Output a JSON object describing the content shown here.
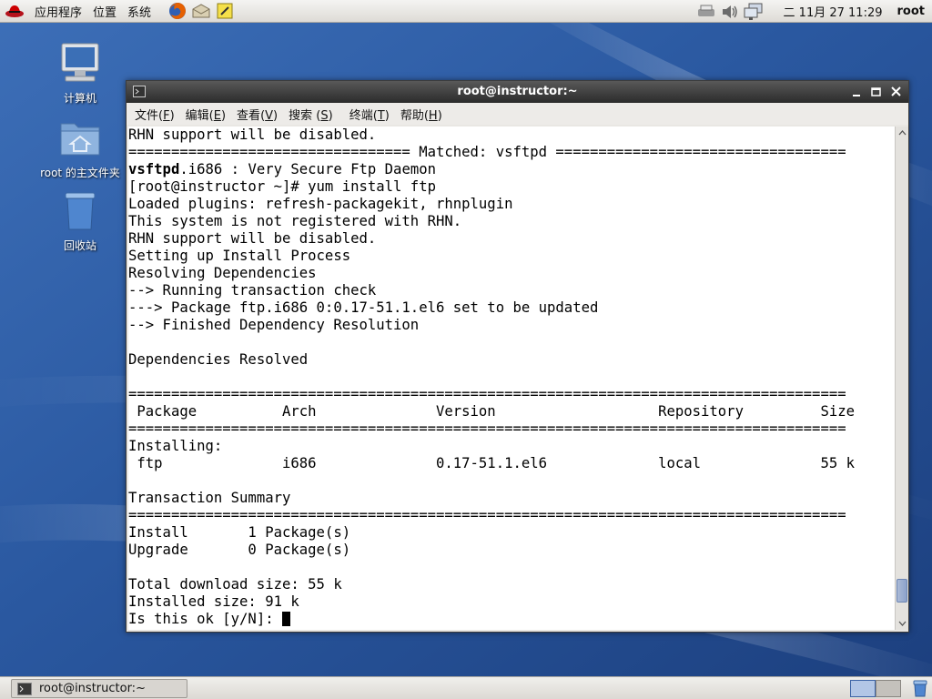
{
  "top_panel": {
    "menus": [
      "应用程序",
      "位置",
      "系统"
    ],
    "clock": "二 11月 27 11:29",
    "user": "root"
  },
  "desktop": {
    "icons": [
      {
        "label": "计算机",
        "icon": "computer-icon"
      },
      {
        "label": "root 的主文件夹",
        "icon": "home-folder-icon"
      },
      {
        "label": "回收站",
        "icon": "trash-icon"
      }
    ]
  },
  "terminal": {
    "title": "root@instructor:~",
    "menu": [
      {
        "label": "文件",
        "key": "F"
      },
      {
        "label": "编辑",
        "key": "E"
      },
      {
        "label": "查看",
        "key": "V"
      },
      {
        "label": "搜索",
        "key": "S"
      },
      {
        "label": "终端",
        "key": "T"
      },
      {
        "label": "帮助",
        "key": "H"
      }
    ],
    "lines": [
      "RHN support will be disabled.",
      "================================= Matched: vsftpd ==================================",
      "vsftpd.i686 : Very Secure Ftp Daemon",
      "[root@instructor ~]# yum install ftp",
      "Loaded plugins: refresh-packagekit, rhnplugin",
      "This system is not registered with RHN.",
      "RHN support will be disabled.",
      "Setting up Install Process",
      "Resolving Dependencies",
      "--> Running transaction check",
      "---> Package ftp.i686 0:0.17-51.1.el6 set to be updated",
      "--> Finished Dependency Resolution",
      "",
      "Dependencies Resolved",
      "",
      "====================================================================================",
      " Package          Arch              Version                   Repository         Size",
      "====================================================================================",
      "Installing:",
      " ftp              i686              0.17-51.1.el6             local              55 k",
      "",
      "Transaction Summary",
      "====================================================================================",
      "Install       1 Package(s)",
      "Upgrade       0 Package(s)",
      "",
      "Total download size: 55 k",
      "Installed size: 91 k",
      "Is this ok [y/N]: "
    ],
    "bold_prefix": {
      "line": 2,
      "text": "vsftpd"
    },
    "scroll_position": 0.97
  },
  "bottom_panel": {
    "task": "root@instructor:~",
    "workspaces": 2,
    "active_workspace": 1
  }
}
